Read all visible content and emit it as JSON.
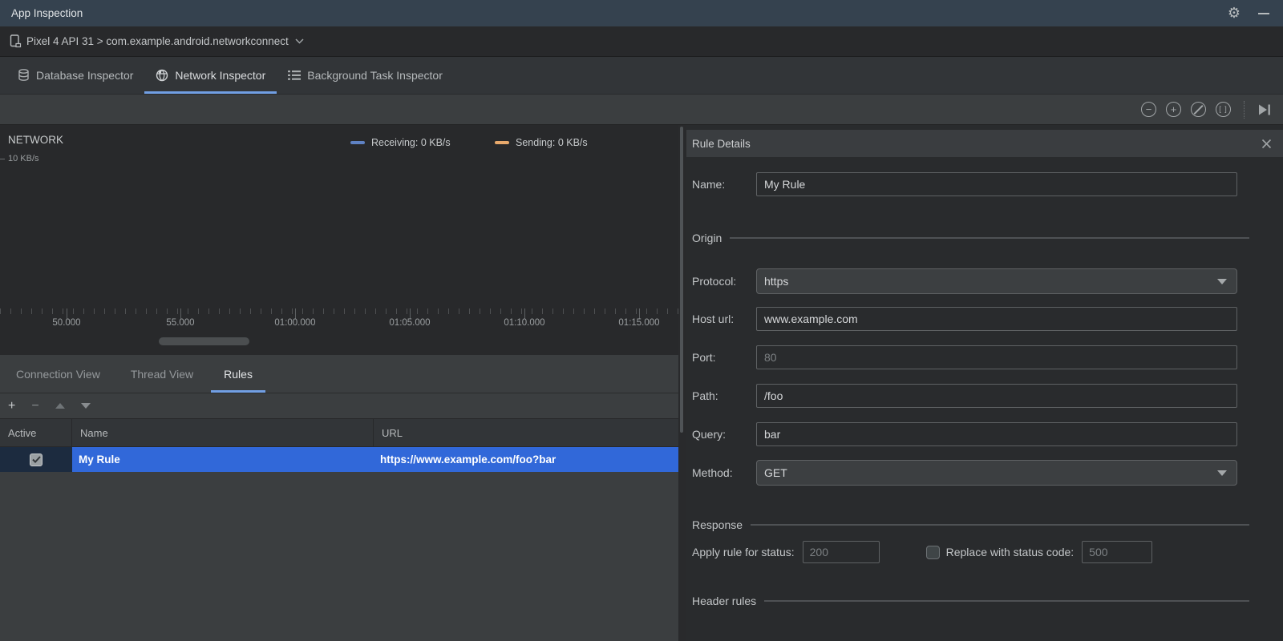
{
  "window": {
    "title": "App Inspection"
  },
  "device_bar": {
    "text": "Pixel 4 API 31 > com.example.android.networkconnect"
  },
  "inspector_tabs": [
    {
      "label": "Database Inspector",
      "selected": false
    },
    {
      "label": "Network Inspector",
      "selected": true
    },
    {
      "label": "Background Task Inspector",
      "selected": false
    }
  ],
  "timeline_toolbar": {
    "zoom_out_glyph": "−",
    "zoom_in_glyph": "+",
    "zoom_to_selection_glyph": "[ ]",
    "icons": [
      "zoom-out",
      "zoom-in",
      "reset-zoom",
      "zoom-to-selection",
      "jump-to-live"
    ]
  },
  "network_chart": {
    "title": "NETWORK",
    "y_axis_label": "10 KB/s",
    "legend": [
      {
        "label": "Receiving: 0 KB/s",
        "color": "#5f82c4"
      },
      {
        "label": "Sending: 0 KB/s",
        "color": "#e8a96c"
      }
    ],
    "ticks": [
      "50.000",
      "55.000",
      "01:00.000",
      "01:05.000",
      "01:10.000",
      "01:15.000"
    ]
  },
  "chart_data": {
    "type": "line",
    "title": "NETWORK",
    "ylabel": "KB/s",
    "ylim": [
      0,
      10
    ],
    "x": [
      "50.000",
      "55.000",
      "01:00.000",
      "01:05.000",
      "01:10.000",
      "01:15.000"
    ],
    "series": [
      {
        "name": "Receiving",
        "values": [
          0,
          0,
          0,
          0,
          0,
          0
        ],
        "color": "#5f82c4"
      },
      {
        "name": "Sending",
        "values": [
          0,
          0,
          0,
          0,
          0,
          0
        ],
        "color": "#e8a96c"
      }
    ],
    "legend_position": "top",
    "grid": false
  },
  "view_tabs": [
    {
      "label": "Connection View",
      "selected": false
    },
    {
      "label": "Thread View",
      "selected": false
    },
    {
      "label": "Rules",
      "selected": true
    }
  ],
  "rules_toolbar": {
    "add_glyph": "+",
    "remove_glyph": "−"
  },
  "rules_table": {
    "columns": [
      "Active",
      "Name",
      "URL"
    ],
    "rows": [
      {
        "active": true,
        "name": "My Rule",
        "url": "https://www.example.com/foo?bar",
        "selected": true
      }
    ]
  },
  "rule_details": {
    "title": "Rule Details",
    "name_label": "Name:",
    "name_value": "My Rule",
    "origin": {
      "header": "Origin",
      "protocol_label": "Protocol:",
      "protocol_value": "https",
      "host_label": "Host url:",
      "host_value": "www.example.com",
      "port_label": "Port:",
      "port_placeholder": "80",
      "path_label": "Path:",
      "path_value": "/foo",
      "query_label": "Query:",
      "query_value": "bar",
      "method_label": "Method:",
      "method_value": "GET"
    },
    "response": {
      "header": "Response",
      "apply_label": "Apply rule for status:",
      "apply_placeholder": "200",
      "replace_checked": false,
      "replace_label": "Replace with status code:",
      "replace_placeholder": "500"
    },
    "header_rules": {
      "header": "Header rules"
    }
  },
  "colors": {
    "titlebar": "#35424f",
    "selection_blue": "#3168d9",
    "tab_underline": "#719fe4",
    "receiving": "#5f82c4",
    "sending": "#e8a96c",
    "active_cell": "#1c2b3f"
  }
}
